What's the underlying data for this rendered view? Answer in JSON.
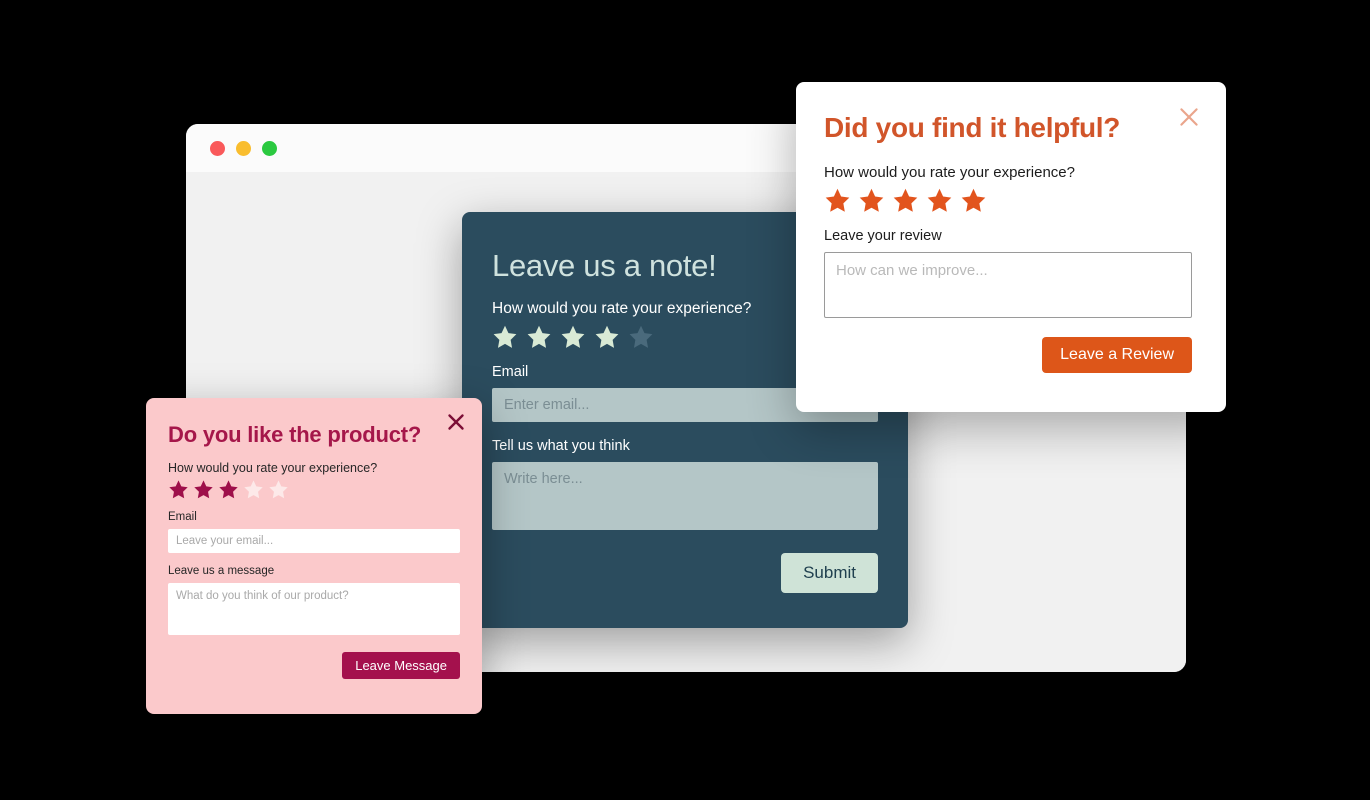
{
  "background_color": "#000000",
  "browser_window": {
    "name": "browser-mockup",
    "titlebar_color": "#fbfbfb",
    "body_color": "#f1f1f1",
    "traffic_lights": [
      {
        "name": "close",
        "color": "#f9595a"
      },
      {
        "name": "minimize",
        "color": "#f9bd2e"
      },
      {
        "name": "maximize",
        "color": "#2bc940"
      }
    ]
  },
  "teal_modal": {
    "accent_color": "#2b4c5e",
    "title": "Leave us a note!",
    "rating_question": "How would you rate your experience?",
    "stars": {
      "total": 5,
      "filled": 4,
      "on_color": "#d9ead5",
      "off_color": "#4a6a7c"
    },
    "email_label": "Email",
    "email_value": "",
    "email_placeholder": "Enter email...",
    "message_label": "Tell us what you think",
    "message_value": "",
    "message_placeholder": "Write here...",
    "submit_label": "Submit",
    "submit_color": "#cfe3d7"
  },
  "white_modal": {
    "accent_color": "#d1552a",
    "title": "Did you find it helpful?",
    "rating_question": "How would you rate your experience?",
    "stars": {
      "total": 5,
      "filled": 5,
      "on_color": "#e2541d",
      "off_color": "#e2541d"
    },
    "review_label": "Leave your review",
    "review_value": "",
    "review_placeholder": "How can we improve...",
    "submit_label": "Leave a Review",
    "submit_color": "#dd5619",
    "close_icon": "close-icon",
    "close_color": "#eaa58c"
  },
  "pink_modal": {
    "accent_color": "#a5174a",
    "background_color": "#fbc9cb",
    "title": "Do you like the product?",
    "rating_question": "How would you rate your experience?",
    "stars": {
      "total": 5,
      "filled": 3,
      "on_color": "#9e0f4a",
      "off_color": "#fde9e9"
    },
    "email_label": "Email",
    "email_value": "",
    "email_placeholder": "Leave your email...",
    "message_label": "Leave us a message",
    "message_value": "",
    "message_placeholder": "What do you think of our product?",
    "submit_label": "Leave Message",
    "submit_color": "#a4114d",
    "close_icon": "close-icon",
    "close_color": "#7c0d36"
  }
}
